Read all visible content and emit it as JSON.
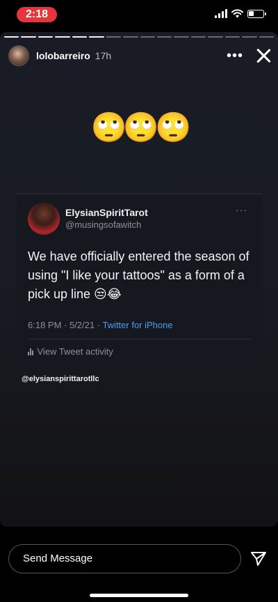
{
  "status_bar": {
    "time": "2:18",
    "battery_level": 0.35
  },
  "story": {
    "progress": {
      "total_segments": 16,
      "completed_segments": 6
    },
    "username": "lolobarreiro",
    "time_ago": "17h",
    "more_label": "•••",
    "emojis": "🙄🙄🙄",
    "tweet": {
      "display_name": "ElysianSpiritTarot",
      "handle": "@musingsofawitch",
      "more_label": "···",
      "text": "We have officially entered the season of using \"I like your tattoos\" as a form of a pick up line 😒😂",
      "timestamp": "6:18 PM · 5/2/21 · ",
      "source": "Twitter for iPhone",
      "activity_label": "View Tweet activity"
    },
    "mention": "@elysianspirittarotllc"
  },
  "composer": {
    "placeholder": "Send Message"
  },
  "colors": {
    "time_pill": "#e5363b",
    "link_blue": "#4aa0f0",
    "muted_text": "#8a9099"
  },
  "icons": [
    "signal-icon",
    "wifi-icon",
    "battery-icon",
    "more-icon",
    "close-icon",
    "bar-chart-icon",
    "send-icon"
  ]
}
